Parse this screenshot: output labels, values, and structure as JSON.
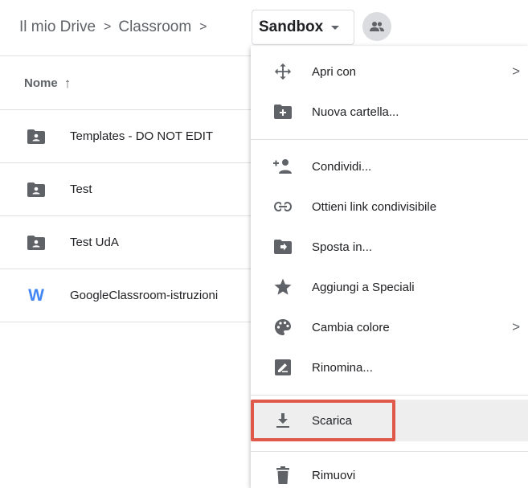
{
  "breadcrumb": {
    "items": [
      "Il mio Drive",
      "Classroom"
    ],
    "separator": ">",
    "current": "Sandbox"
  },
  "list": {
    "header": {
      "name_label": "Nome",
      "sort_icon": "arrow-up-icon"
    },
    "rows": [
      {
        "name": "Templates - DO NOT EDIT",
        "icon": "shared-folder-icon"
      },
      {
        "name": "Test",
        "icon": "shared-folder-icon"
      },
      {
        "name": "Test UdA",
        "icon": "shared-folder-icon"
      },
      {
        "name": "GoogleClassroom-istruzioni",
        "icon": "word-doc-icon",
        "icon_text": "W"
      }
    ]
  },
  "context_menu": {
    "items": [
      {
        "label": "Apri con",
        "icon": "move-arrows-icon",
        "submenu": ">"
      },
      {
        "label": "Nuova cartella...",
        "icon": "new-folder-icon"
      },
      {
        "label": "Condividi...",
        "icon": "add-person-icon"
      },
      {
        "label": "Ottieni link condivisibile",
        "icon": "link-icon"
      },
      {
        "label": "Sposta in...",
        "icon": "move-to-folder-icon"
      },
      {
        "label": "Aggiungi a Speciali",
        "icon": "star-icon"
      },
      {
        "label": "Cambia colore",
        "icon": "palette-icon",
        "submenu": ">"
      },
      {
        "label": "Rinomina...",
        "icon": "rename-icon"
      },
      {
        "label": "Scarica",
        "icon": "download-icon"
      },
      {
        "label": "Rimuovi",
        "icon": "trash-icon"
      }
    ],
    "hovered_item": "Scarica"
  },
  "colors": {
    "icon_gray": "#5f6368",
    "word_blue": "#4285f4",
    "highlight_red": "#e0584a",
    "hover_bg": "#eeeeee"
  }
}
